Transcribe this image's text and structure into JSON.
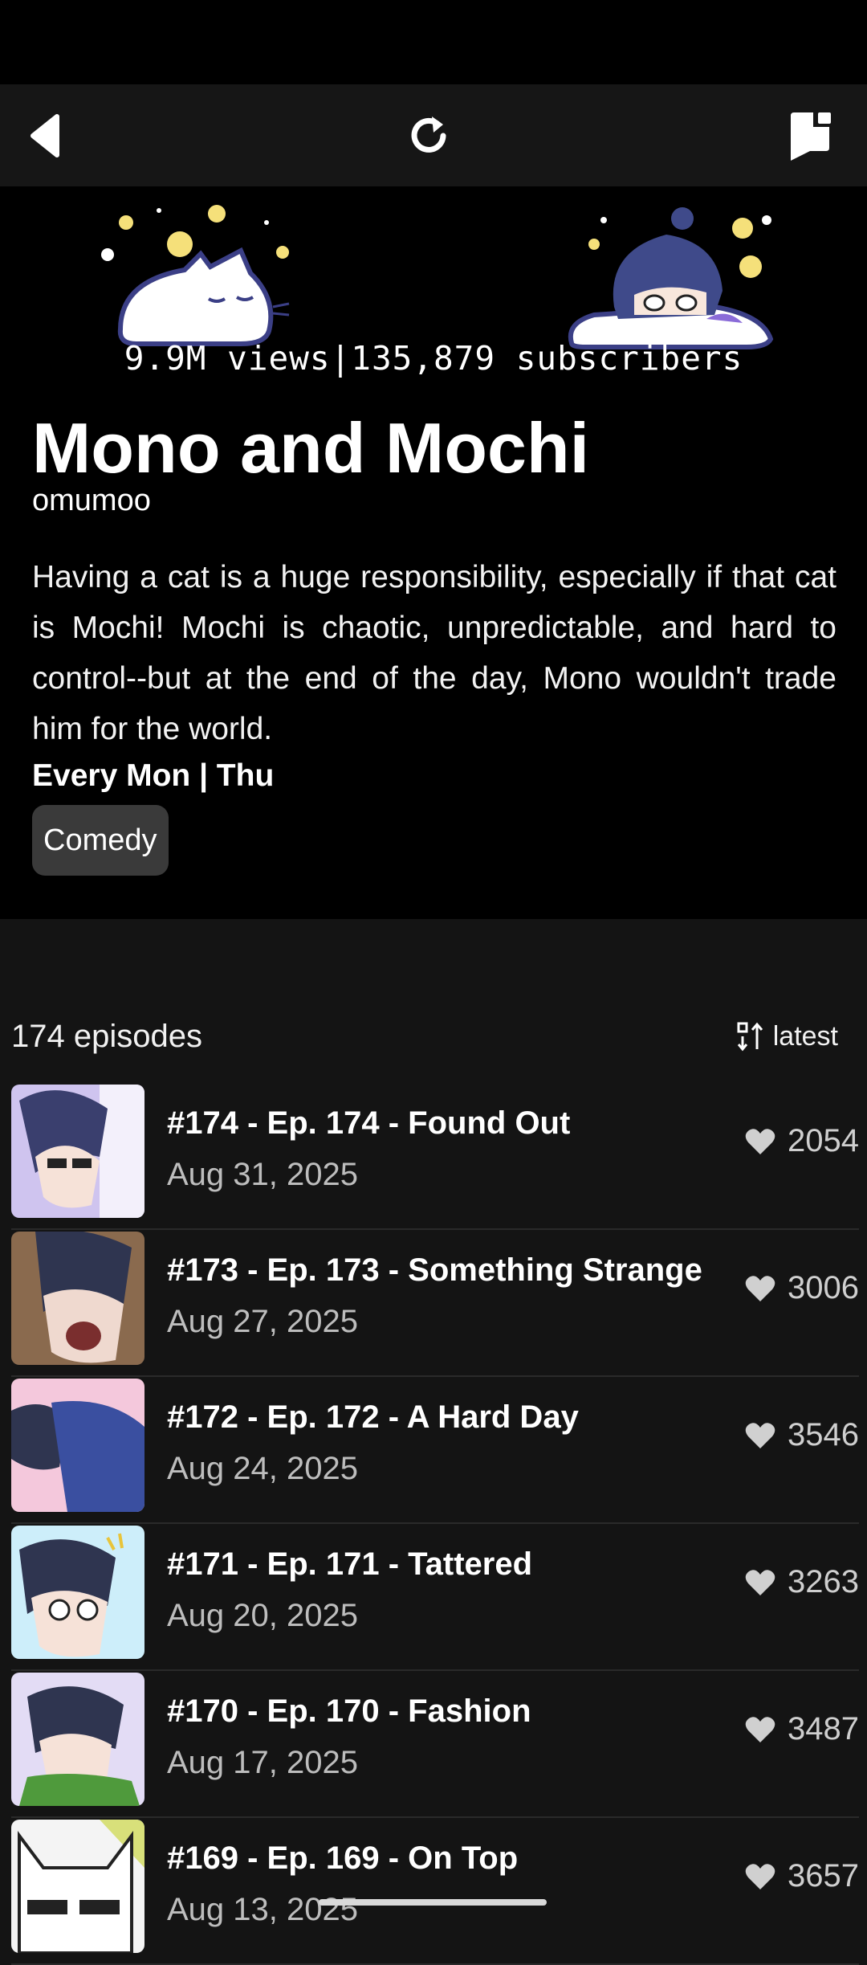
{
  "toolbar": {
    "back_icon": "back-arrow-icon",
    "refresh_icon": "refresh-icon",
    "bookmark_icon": "bookmark-flag-icon"
  },
  "series": {
    "stats": "9.9M views|135,879 subscribers",
    "title": "Mono and Mochi",
    "author": "omumoo",
    "description": "Having a cat is a huge responsibility, especially if that cat is Mochi! Mochi is chaotic, unpredictable, and hard to control--but at the end of the day, Mono wouldn't trade him for the world.",
    "schedule": "Every Mon | Thu",
    "genre": "Comedy"
  },
  "episodes_header": {
    "count": "174 episodes",
    "sort_label": "latest"
  },
  "episodes": [
    {
      "title": "#174 - Ep. 174 - Found Out",
      "date": "Aug 31, 2025",
      "likes": "2054",
      "thumb_bg": "#cfc4ef"
    },
    {
      "title": "#173 - Ep. 173 - Something Strange",
      "date": "Aug 27, 2025",
      "likes": "3006",
      "thumb_bg": "#8a6a4e"
    },
    {
      "title": "#172 - Ep. 172 - A Hard Day",
      "date": "Aug 24, 2025",
      "likes": "3546",
      "thumb_bg": "#f4c8dc"
    },
    {
      "title": "#171 - Ep. 171 - Tattered",
      "date": "Aug 20, 2025",
      "likes": "3263",
      "thumb_bg": "#cdeefa"
    },
    {
      "title": "#170 - Ep. 170 - Fashion",
      "date": "Aug 17, 2025",
      "likes": "3487",
      "thumb_bg": "#e3dcf5"
    },
    {
      "title": "#169 - Ep. 169 - On Top",
      "date": "Aug 13, 2025",
      "likes": "3657",
      "thumb_bg": "#f4f4f4"
    }
  ],
  "colors": {
    "background": "#141414",
    "hero_background": "#000000",
    "genre_chip": "#3a3a3a",
    "muted_text": "#bdbdbd"
  }
}
